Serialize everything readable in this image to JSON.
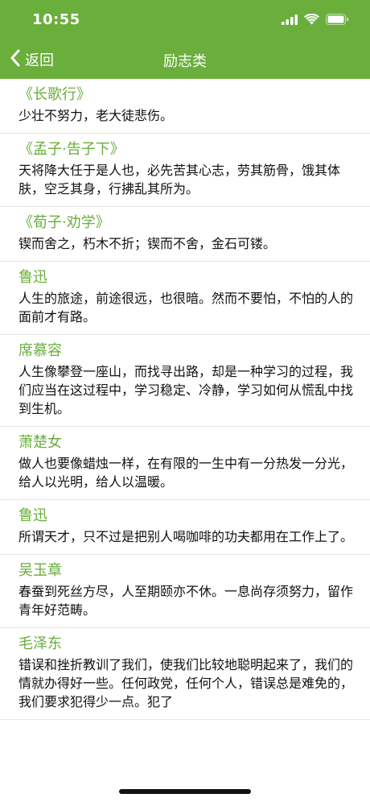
{
  "status_bar": {
    "time": "10:55"
  },
  "nav": {
    "back_label": "返回",
    "title": "励志类"
  },
  "quotes": [
    {
      "source": "《长歌行》",
      "text": "少壮不努力，老大徒悲伤。"
    },
    {
      "source": "《孟子·告子下》",
      "text": "天将降大任于是人也，必先苦其心志，劳其筋骨，饿其体肤，空乏其身，行拂乱其所为。"
    },
    {
      "source": "《荀子·劝学》",
      "text": "锲而舍之，朽木不折；锲而不舍，金石可镂。"
    },
    {
      "source": "鲁迅",
      "text": "人生的旅途，前途很远，也很暗。然而不要怕，不怕的人的面前才有路。"
    },
    {
      "source": "席慕容",
      "text": "人生像攀登一座山，而找寻出路，却是一种学习的过程，我们应当在这过程中，学习稳定、冷静，学习如何从慌乱中找到生机。"
    },
    {
      "source": "萧楚女",
      "text": "做人也要像蜡烛一样，在有限的一生中有一分热发一分光，给人以光明，给人以温暖。"
    },
    {
      "source": "鲁迅",
      "text": "所谓天才，只不过是把别人喝咖啡的功夫都用在工作上了。"
    },
    {
      "source": "吴玉章",
      "text": "春蚕到死丝方尽，人至期颐亦不休。一息尚存须努力，留作青年好范畴。"
    },
    {
      "source": "毛泽东",
      "text": "错误和挫折教训了我们，使我们比较地聪明起来了，我们的情就办得好一些。任何政党，任何个人，错误总是难免的，我们要求犯得少一点。犯了"
    }
  ],
  "colors": {
    "accent": "#6aae3c"
  }
}
